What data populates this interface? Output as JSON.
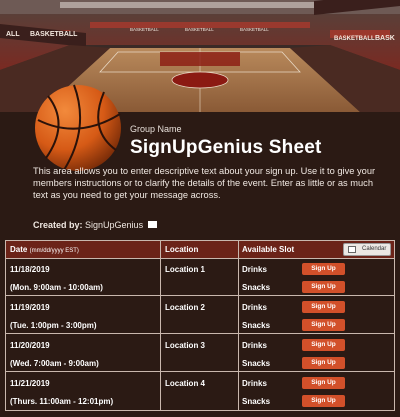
{
  "banner": {
    "signs": [
      "ALL",
      "BASKETBALL",
      "BASKETBALL",
      "BASKETBALL",
      "BASKETBALL",
      "BASKETBALL",
      "BASK"
    ]
  },
  "header": {
    "group_label": "Group Name",
    "title": "SignUpGenius Sheet"
  },
  "description": "This area allows you to enter descriptive text about your sign up. Use it to give your members instructions or to clarify the details of the event. Enter as little or as much text as you need to get your message across.",
  "created": {
    "label": "Created by:",
    "name": "SignUpGenius",
    "icon": "mail-icon"
  },
  "table": {
    "headers": {
      "date": "Date",
      "date_format": "(mm/dd/yyyy EST)",
      "location": "Location",
      "slot": "Available Slot",
      "calendar": "Calendar"
    },
    "rows": [
      {
        "date": "11/18/2019",
        "time": "(Mon. 9:00am - 10:00am)",
        "location": "Location 1",
        "slots": [
          "Drinks",
          "Snacks"
        ]
      },
      {
        "date": "11/19/2019",
        "time": "(Tue. 1:00pm - 3:00pm)",
        "location": "Location 2",
        "slots": [
          "Drinks",
          "Snacks"
        ]
      },
      {
        "date": "11/20/2019",
        "time": "(Wed. 7:00am - 9:00am)",
        "location": "Location 3",
        "slots": [
          "Drinks",
          "Snacks"
        ]
      },
      {
        "date": "11/21/2019",
        "time": "(Thurs. 11:00am - 12:01pm)",
        "location": "Location 4",
        "slots": [
          "Drinks",
          "Snacks"
        ]
      }
    ],
    "signup_label": "Sign Up"
  },
  "colors": {
    "background": "#2b1a14",
    "header": "#6b2318",
    "button": "#d2502a",
    "border": "#c9b7ad"
  }
}
